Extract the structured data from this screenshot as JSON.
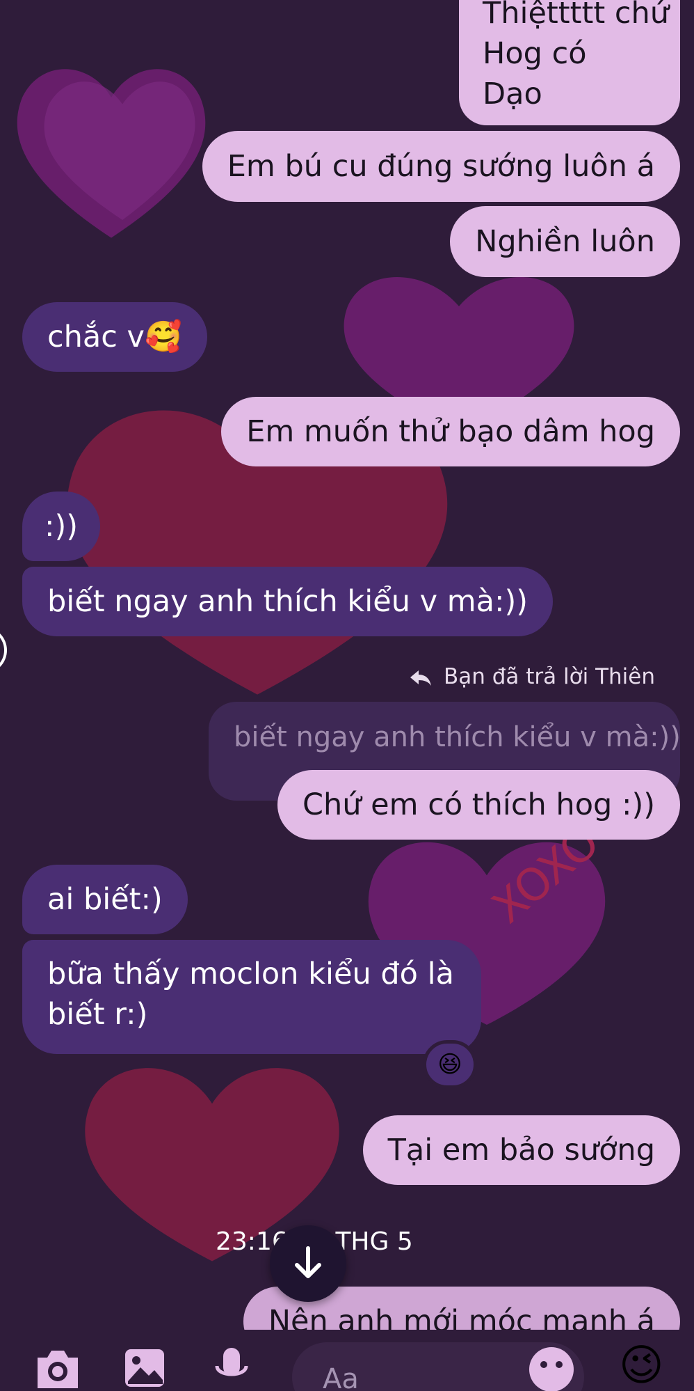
{
  "messages": {
    "m1": {
      "lines": [
        "Thiệttttt chứ",
        "Hog có",
        "Dạo"
      ]
    },
    "m2": "Em bú cu đúng sướng luôn á",
    "m3": "Nghiền luôn",
    "m4": "chắc v🥰",
    "m5": "Em muốn thử bạo dâm hog",
    "m6": ":))",
    "m7": "biết ngay anh thích kiểu v mà:))",
    "m8": "Chứ em có thích hog :))",
    "m9": "ai biết:)",
    "m10": {
      "lines": [
        "bữa thấy moclon kiểu đó là",
        "biết r:)"
      ]
    },
    "m11": "Tại em bảo sướng",
    "m12": "Nên anh mới móc mạnh á"
  },
  "reply": {
    "label": "Bạn đã trả lời Thiên",
    "quoted": "biết ngay anh thích kiểu v mà:))"
  },
  "reaction_emoji": "😆",
  "timestamp": "23:16 18 THG 5",
  "composer": {
    "placeholder": "Aa",
    "quick_emoji": "😉"
  },
  "colors": {
    "background": "#2f1c3a",
    "outgoing_bubble": "#e2bbe6",
    "incoming_bubble": "#4a2e73",
    "heart_purple": "#6e1f70",
    "heart_red": "#7d1e42"
  },
  "icons": [
    "camera-icon",
    "image-icon",
    "microphone-icon",
    "emoji-icon",
    "arrow-down-icon",
    "reply-arrow-icon",
    "heart-decoration"
  ]
}
